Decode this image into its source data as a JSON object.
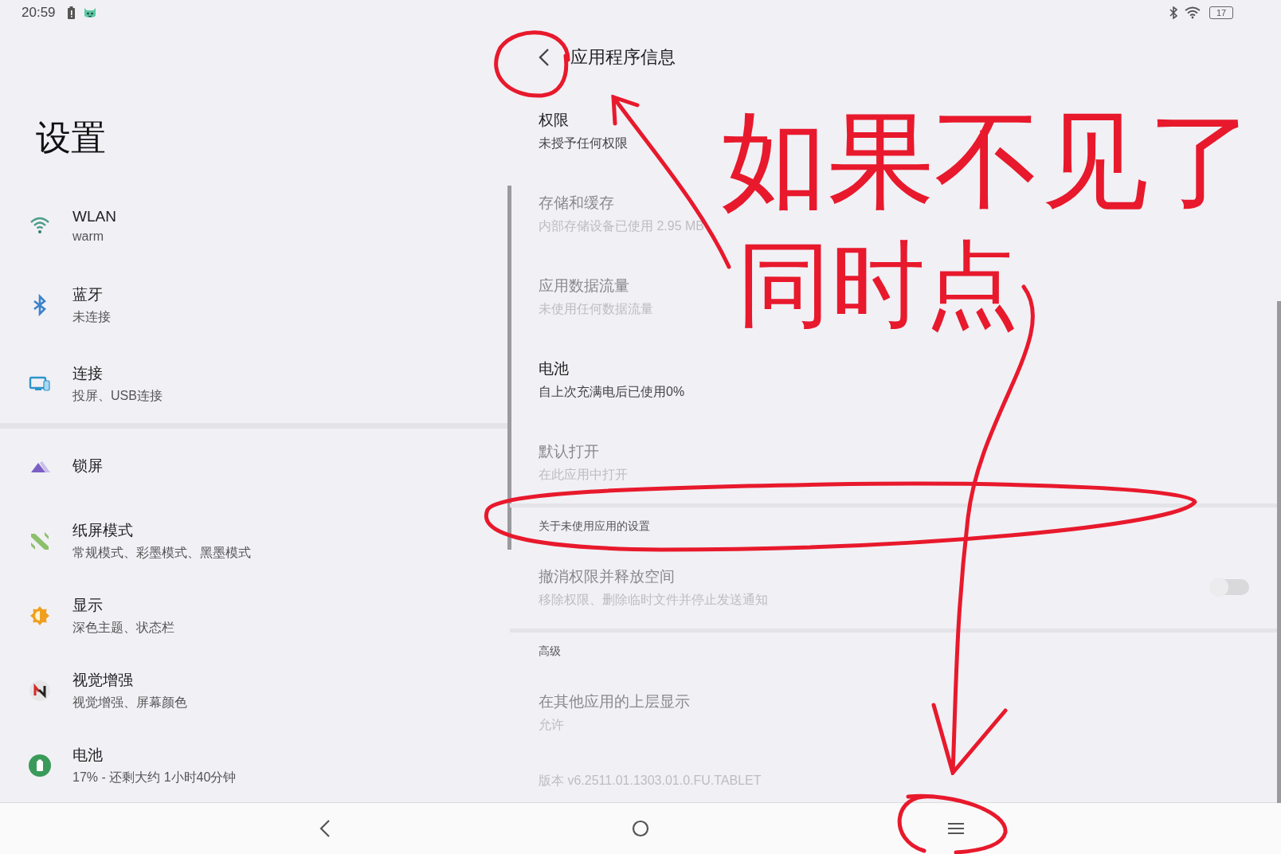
{
  "status_bar": {
    "time": "20:59",
    "battery_percent": "17"
  },
  "settings": {
    "title": "设置",
    "groups": [
      {
        "items": [
          {
            "kind": "wifi",
            "title": "WLAN",
            "subtitle": "warm"
          },
          {
            "kind": "bluetooth",
            "title": "蓝牙",
            "subtitle": "未连接"
          },
          {
            "kind": "connection",
            "title": "连接",
            "subtitle": "投屏、USB连接"
          }
        ]
      },
      {
        "items": [
          {
            "kind": "lockscreen",
            "title": "锁屏"
          },
          {
            "kind": "paper",
            "title": "纸屏模式",
            "subtitle": "常规模式、彩墨模式、黑墨模式"
          },
          {
            "kind": "display",
            "title": "显示",
            "subtitle": "深色主题、状态栏"
          },
          {
            "kind": "visual",
            "title": "视觉增强",
            "subtitle": "视觉增强、屏幕颜色"
          },
          {
            "kind": "battery",
            "title": "电池",
            "subtitle": "17% - 还剩大约 1小时40分钟"
          }
        ]
      }
    ]
  },
  "app_info": {
    "title": "应用程序信息",
    "sections": [
      {
        "items": [
          {
            "kind": "entry",
            "title": "权限",
            "subtitle": "未授予任何权限",
            "disabled": false
          },
          {
            "kind": "entry",
            "title": "存储和缓存",
            "subtitle": "内部存储设备已使用 2.95 MB",
            "disabled": true
          },
          {
            "kind": "entry",
            "title": "应用数据流量",
            "subtitle": "未使用任何数据流量",
            "disabled": true
          },
          {
            "kind": "entry",
            "title": "电池",
            "subtitle": "自上次充满电后已使用0%",
            "disabled": false
          },
          {
            "kind": "entry",
            "title": "默认打开",
            "subtitle": "在此应用中打开",
            "disabled": true
          }
        ]
      },
      {
        "header": "关于未使用应用的设置",
        "items": [
          {
            "kind": "toggle",
            "title": "撤消权限并释放空间",
            "subtitle": "移除权限、删除临时文件并停止发送通知",
            "disabled": true,
            "on": false
          }
        ]
      },
      {
        "header": "高级",
        "items": [
          {
            "kind": "entry",
            "title": "在其他应用的上层显示",
            "subtitle": "允许",
            "disabled": true
          }
        ]
      }
    ],
    "version": "版本 v6.2511.01.1303.01.0.FU.TABLET"
  },
  "annotation": {
    "texts": [
      {
        "kind": "top",
        "text": "如果不见了"
      },
      {
        "kind": "middle",
        "text": "同时点"
      }
    ]
  }
}
